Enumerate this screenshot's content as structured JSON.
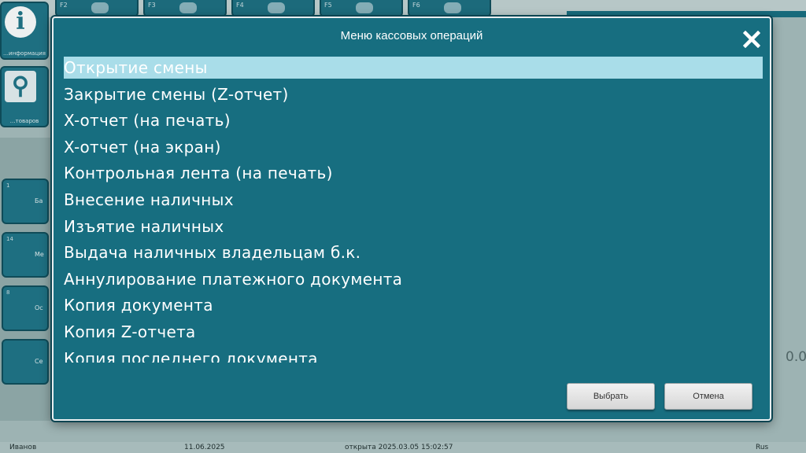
{
  "background": {
    "toolbar": {
      "tabs": [
        {
          "key": "F2"
        },
        {
          "key": "F3"
        },
        {
          "key": "F4"
        },
        {
          "key": "F5"
        },
        {
          "key": "F6"
        }
      ]
    },
    "left_buttons": [
      {
        "icon": "info-icon",
        "label": "…информация"
      },
      {
        "icon": "search-goods-icon",
        "label": "…товаров"
      }
    ],
    "side_buttons": [
      {
        "num": "1",
        "label": "Ба"
      },
      {
        "num": "14",
        "label": "Ме"
      },
      {
        "num": "8",
        "label": "Ос"
      },
      {
        "num": "",
        "label": "Се"
      }
    ],
    "right_value": "0.0",
    "status_bar": {
      "user": "Иванов",
      "date": "11.06.2025",
      "shift": "открыта 2025.03.05 15:02:57",
      "lang": "Rus"
    }
  },
  "modal": {
    "title": "Меню кассовых операций",
    "close_icon": "close-x-icon",
    "items": [
      {
        "label": "Открытие смены",
        "selected": true
      },
      {
        "label": "Закрытие смены (Z-отчет)",
        "selected": false
      },
      {
        "label": "X-отчет (на печать)",
        "selected": false
      },
      {
        "label": "X-отчет (на экран)",
        "selected": false
      },
      {
        "label": "Контрольная лента (на печать)",
        "selected": false
      },
      {
        "label": "Внесение наличных",
        "selected": false
      },
      {
        "label": "Изъятие наличных",
        "selected": false
      },
      {
        "label": "Выдача наличных владельцам б.к.",
        "selected": false
      },
      {
        "label": "Аннулирование платежного документа",
        "selected": false
      },
      {
        "label": "Копия документа",
        "selected": false
      },
      {
        "label": "Копия Z-отчета",
        "selected": false
      },
      {
        "label": "Копия последнего документа",
        "selected": false
      }
    ],
    "buttons": {
      "select_label": "Выбрать",
      "cancel_label": "Отмена"
    }
  },
  "colors": {
    "modal_bg": "#176e80",
    "selection": "#a9dde9",
    "app_bg": "#a9bdbd"
  }
}
